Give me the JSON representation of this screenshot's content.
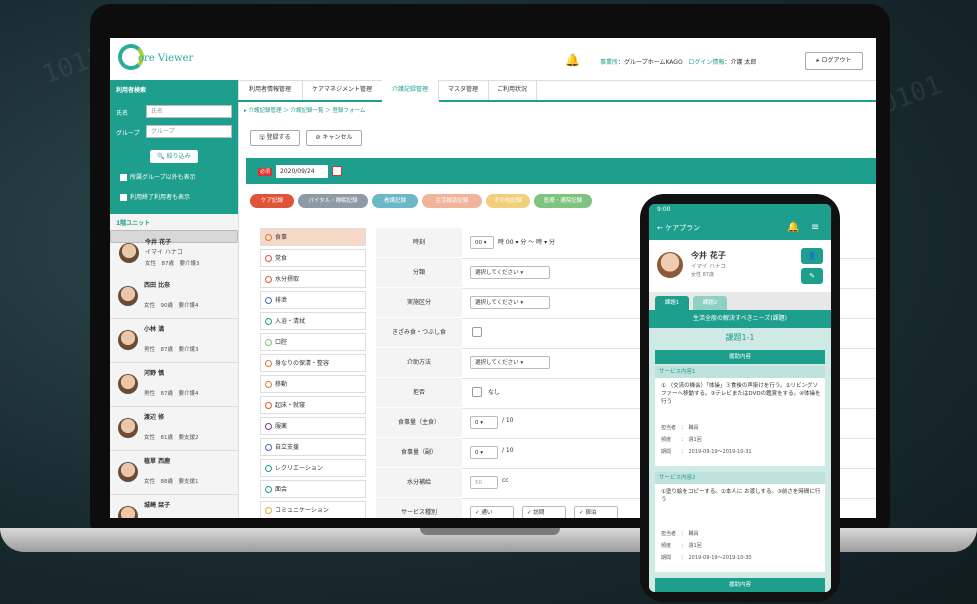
{
  "header": {
    "logo_text": "ore Viewer",
    "facility_label": "事業所",
    "facility_value": "：グループホームKAGO",
    "user_label": "ログイン情報",
    "user_value": "：介護 太郎",
    "logout_label": "▸ ログアウト"
  },
  "sidebar": {
    "title": "利用者検索",
    "name_label": "氏名",
    "name_placeholder": "氏名",
    "group_label": "グループ",
    "group_placeholder": "グループ",
    "search_label": "🔍 絞り込み",
    "chk_other_group": "所属グループ以外も表示",
    "chk_ended": "利用終了利用者も表示",
    "unit_label": "1階ユニット",
    "residents": [
      {
        "name": "今井 花子",
        "kana": "イマイ ハナコ",
        "meta": "女性　87歳　要介護3"
      },
      {
        "name": "西田 比奈",
        "kana": "",
        "meta": "女性　90歳　要介護4"
      },
      {
        "name": "小林 満",
        "kana": "",
        "meta": "男性　87歳　要介護3"
      },
      {
        "name": "河野 慎",
        "kana": "",
        "meta": "男性　87歳　要介護4"
      },
      {
        "name": "渡辺 修",
        "kana": "",
        "meta": "女性　81歳　要支援2"
      },
      {
        "name": "植草 西鹿",
        "kana": "",
        "meta": "女性　88歳　要支援1"
      },
      {
        "name": "城崎 栞子",
        "kana": "",
        "meta": ""
      }
    ]
  },
  "tabs": [
    "利用者情報管理",
    "ケアマネジメント管理",
    "介護記録管理",
    "マスタ管理",
    "ご利用状況"
  ],
  "breadcrumb": "▸ 介護記録管理 ＞ 介護記録一覧 ＞ 登録フォーム",
  "actions": {
    "register": "🖫 登録する",
    "cancel": "⊘ キャンセル"
  },
  "form": {
    "required": "必須",
    "date": "2020/09/24",
    "categories": [
      {
        "label": "ケア記録",
        "color": "#e0553a"
      },
      {
        "label": "バイタル・睡眠記録",
        "color": "#8e9aa5"
      },
      {
        "label": "看護記録",
        "color": "#6cb8c9"
      },
      {
        "label": "生活援助記録",
        "color": "#f0b49a"
      },
      {
        "label": "その他記録",
        "color": "#f2cf7a"
      },
      {
        "label": "医療・通院記録",
        "color": "#7ec47e"
      }
    ],
    "nav_items": [
      {
        "label": "食事",
        "color": "#e07a2e"
      },
      {
        "label": "覚食",
        "color": "#e0553a"
      },
      {
        "label": "水分摂取",
        "color": "#e0553a"
      },
      {
        "label": "排泄",
        "color": "#4a6bb0"
      },
      {
        "label": "入浴・清拭",
        "color": "#1e9e8c"
      },
      {
        "label": "口腔",
        "color": "#7ec47e"
      },
      {
        "label": "身なりの保清・整容",
        "color": "#e07a2e"
      },
      {
        "label": "移動",
        "color": "#e07a2e"
      },
      {
        "label": "起床・就寝",
        "color": "#e0553a"
      },
      {
        "label": "服薬",
        "color": "#7a3e8e"
      },
      {
        "label": "自立支援",
        "color": "#4a6bb0"
      },
      {
        "label": "レクリエーション",
        "color": "#1e9e8c"
      },
      {
        "label": "面会",
        "color": "#1e9e8c"
      },
      {
        "label": "コミュニケーション",
        "color": "#e0b030"
      }
    ],
    "rows": {
      "time_label": "時刻",
      "time_value": "時 00 ▾ 分 〜 時 ▾ 分",
      "hour": "00 ▾",
      "kind_label": "分類",
      "kind_value": "選択してください ▾",
      "section_label": "実施区分",
      "section_value": "選択してください ▾",
      "mince_label": "きざみ食・つぶし食",
      "assist_label": "介助方法",
      "assist_value": "選択してください ▾",
      "refuse_label": "拒否",
      "refuse_value": "なし",
      "main_label": "食事量（主食）",
      "main_value": "0 ▾",
      "main_unit": "/ 10",
      "side_label": "食事量（副）",
      "side_value": "0 ▾",
      "side_unit": "/ 10",
      "water_label": "水分補給",
      "water_value": "50",
      "water_unit": "cc",
      "service_label": "サービス種別",
      "service_opts": [
        "✓ 通い",
        "✓ 訪問",
        "✓ 宿泊"
      ]
    }
  },
  "phone": {
    "status_time": "9:00",
    "title": "← ケアプラン",
    "name": "今井 花子",
    "kana": "イマイ ハナコ",
    "meta": "女性 87歳",
    "tab1": "課題1",
    "tab2": "課題2",
    "band": "生活全般の解決すべきニーズ(課題)",
    "issue_title": "課題1-1",
    "section_head": "援助内容",
    "service1": "サービス内容1",
    "service1_text": "① （交流の機会）「体操」３食後の声掛けを行う。②リビングソファーへ移動する。③テレビまたはDVDの鑑賞をする。④体操を行う",
    "kv1_a": "担当者　：　職員",
    "kv1_b": "頻度　　：　週1回",
    "kv1_c": "期間　　：　2019-09-19〜2019-10-31",
    "service2": "サービス内容2",
    "service2_text": "①塗り絵をコピーする。②本人に お渡しする。③前さを時間に行う",
    "kv2_a": "担当者　：　職員",
    "kv2_b": "頻度　　：　週1回",
    "kv2_c": "期間　　：　2019-09-19〜2019-10-30",
    "bottom_head": "援助内容"
  }
}
